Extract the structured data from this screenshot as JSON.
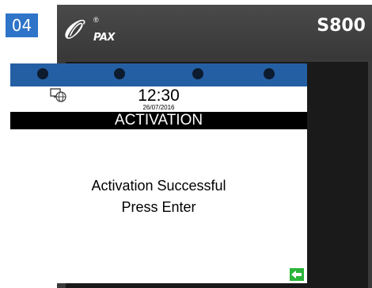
{
  "step": {
    "number": "04"
  },
  "device": {
    "brand": "PAX",
    "registered": "®",
    "model": "S800"
  },
  "screen": {
    "time": "12:30",
    "date": "26/07/2016",
    "title": "ACTIVATION",
    "message_line1": "Activation Successful",
    "message_line2": "Press Enter"
  },
  "icons": {
    "network": "network-globe-icon",
    "enter": "enter-arrow-icon",
    "status_dots": [
      "status-dot",
      "status-dot",
      "status-dot",
      "status-dot"
    ]
  },
  "colors": {
    "badge": "#2e74c8",
    "status_bar": "#245fa3",
    "title_bar": "#000000",
    "enter_button": "#2ab43a",
    "device_body": "#3a3a3a"
  }
}
